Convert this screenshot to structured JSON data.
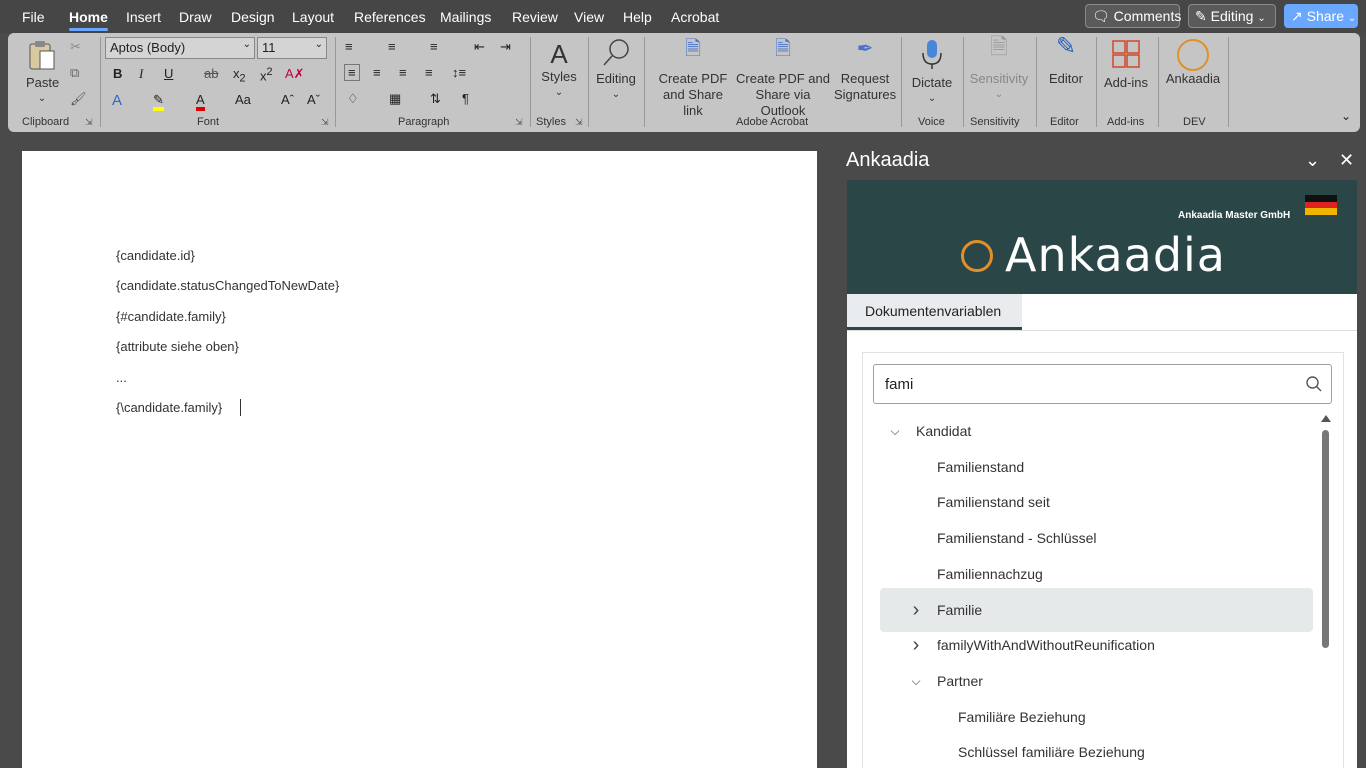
{
  "menu": {
    "tabs": [
      "File",
      "Home",
      "Insert",
      "Draw",
      "Design",
      "Layout",
      "References",
      "Mailings",
      "Review",
      "View",
      "Help",
      "Acrobat"
    ],
    "comments": "Comments",
    "editing": "Editing",
    "share": "Share"
  },
  "ribbon": {
    "paste": "Paste",
    "font_name": "Aptos (Body)",
    "font_size": "11",
    "styles": "Styles",
    "editing": "Editing",
    "create_pdf_1": "Create PDF",
    "create_pdf_2": "and Share link",
    "create_outlook_1": "Create PDF and",
    "create_outlook_2": "Share via Outlook",
    "request_1": "Request",
    "request_2": "Signatures",
    "dictate": "Dictate",
    "sensitivity": "Sensitivity",
    "editor": "Editor",
    "addins": "Add-ins",
    "ankaadia": "Ankaadia",
    "groups": {
      "clipboard": "Clipboard",
      "font": "Font",
      "paragraph": "Paragraph",
      "styles": "Styles",
      "adobe": "Adobe Acrobat",
      "voice": "Voice",
      "sensitivity": "Sensitivity",
      "editor": "Editor",
      "addins": "Add-ins",
      "dev": "DEV"
    }
  },
  "document": {
    "lines": [
      "{candidate.id}",
      "{candidate.statusChangedToNewDate}",
      "{#candidate.family}",
      " {attribute siehe oben}",
      " ...",
      " {\\candidate.family}"
    ]
  },
  "pane": {
    "title": "Ankaadia",
    "company": "Ankaadia Master GmbH",
    "logo": "Ankaadia",
    "tab": "Dokumentenvariablen",
    "search_value": "fami",
    "tree": [
      {
        "label": "Kandidat",
        "level": 0,
        "chevron": "down"
      },
      {
        "label": "Familienstand",
        "level": 1,
        "chevron": ""
      },
      {
        "label": "Familienstand seit",
        "level": 1,
        "chevron": ""
      },
      {
        "label": "Familienstand - Schlüssel",
        "level": 1,
        "chevron": ""
      },
      {
        "label": "Familiennachzug",
        "level": 1,
        "chevron": ""
      },
      {
        "label": "Familie",
        "level": 1,
        "chevron": "right"
      },
      {
        "label": "familyWithAndWithoutReunification",
        "level": 1,
        "chevron": "right"
      },
      {
        "label": "Partner",
        "level": 1,
        "chevron": "down"
      },
      {
        "label": "Familiäre Beziehung",
        "level": 2,
        "chevron": ""
      },
      {
        "label": "Schlüssel familiäre Beziehung",
        "level": 2,
        "chevron": ""
      }
    ],
    "selected_index": 5,
    "colors": {
      "banner": "#2a4646",
      "accent": "#e0902a"
    }
  }
}
